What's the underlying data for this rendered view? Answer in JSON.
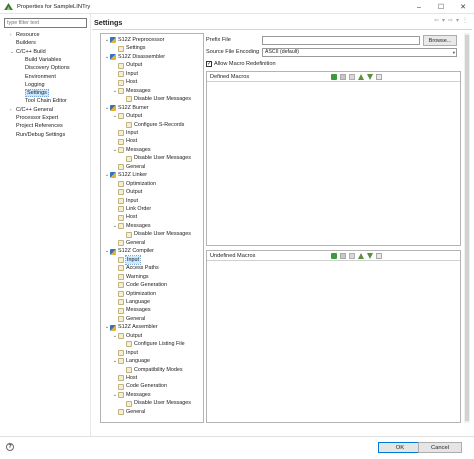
{
  "window": {
    "title": "Properties for SampleLINTry",
    "controls": [
      "–",
      "☐",
      "✕"
    ]
  },
  "filter": {
    "placeholder": "type filter text"
  },
  "nav": [
    {
      "label": "Resource",
      "depth": 1,
      "toggle": "›"
    },
    {
      "label": "Builders",
      "depth": 1,
      "toggle": ""
    },
    {
      "label": "C/C++ Build",
      "depth": 1,
      "toggle": "⌄"
    },
    {
      "label": "Build Variables",
      "depth": 2,
      "toggle": ""
    },
    {
      "label": "Discovery Options",
      "depth": 2,
      "toggle": ""
    },
    {
      "label": "Environment",
      "depth": 2,
      "toggle": ""
    },
    {
      "label": "Logging",
      "depth": 2,
      "toggle": ""
    },
    {
      "label": "Settings",
      "depth": 2,
      "toggle": "",
      "selected": true
    },
    {
      "label": "Tool Chain Editor",
      "depth": 2,
      "toggle": ""
    },
    {
      "label": "C/C++ General",
      "depth": 1,
      "toggle": "›"
    },
    {
      "label": "Processor Expert",
      "depth": 1,
      "toggle": ""
    },
    {
      "label": "Project References",
      "depth": 1,
      "toggle": ""
    },
    {
      "label": "Run/Debug Settings",
      "depth": 1,
      "toggle": ""
    }
  ],
  "page_title": "Settings",
  "nav_arrows": [
    "⇦",
    "▾",
    "⇨",
    "▾",
    "⋮"
  ],
  "tool_tree": [
    {
      "label": "S12Z Preprocessor",
      "depth": 0,
      "type": "tool"
    },
    {
      "label": "Settings",
      "depth": 1,
      "type": "opt"
    },
    {
      "label": "S12Z Disassembler",
      "depth": 0,
      "type": "tool"
    },
    {
      "label": "Output",
      "depth": 1,
      "type": "opt"
    },
    {
      "label": "Input",
      "depth": 1,
      "type": "opt"
    },
    {
      "label": "Host",
      "depth": 1,
      "type": "opt"
    },
    {
      "label": "Messages",
      "depth": 1,
      "type": "opt",
      "expanded": true
    },
    {
      "label": "Disable User Messages",
      "depth": 2,
      "type": "opt"
    },
    {
      "label": "S12Z Burner",
      "depth": 0,
      "type": "tool"
    },
    {
      "label": "Output",
      "depth": 1,
      "type": "opt",
      "expanded": true
    },
    {
      "label": "Configure S-Records",
      "depth": 2,
      "type": "opt"
    },
    {
      "label": "Input",
      "depth": 1,
      "type": "opt"
    },
    {
      "label": "Host",
      "depth": 1,
      "type": "opt"
    },
    {
      "label": "Messages",
      "depth": 1,
      "type": "opt",
      "expanded": true
    },
    {
      "label": "Disable User Messages",
      "depth": 2,
      "type": "opt"
    },
    {
      "label": "General",
      "depth": 1,
      "type": "opt"
    },
    {
      "label": "S12Z Linker",
      "depth": 0,
      "type": "tool"
    },
    {
      "label": "Optimization",
      "depth": 1,
      "type": "opt"
    },
    {
      "label": "Output",
      "depth": 1,
      "type": "opt"
    },
    {
      "label": "Input",
      "depth": 1,
      "type": "opt"
    },
    {
      "label": "Link Order",
      "depth": 1,
      "type": "opt"
    },
    {
      "label": "Host",
      "depth": 1,
      "type": "opt"
    },
    {
      "label": "Messages",
      "depth": 1,
      "type": "opt",
      "expanded": true
    },
    {
      "label": "Disable User Messages",
      "depth": 2,
      "type": "opt"
    },
    {
      "label": "General",
      "depth": 1,
      "type": "opt"
    },
    {
      "label": "S12Z Compiler",
      "depth": 0,
      "type": "tool"
    },
    {
      "label": "Input",
      "depth": 1,
      "type": "opt",
      "selected": true
    },
    {
      "label": "Access Paths",
      "depth": 1,
      "type": "opt"
    },
    {
      "label": "Warnings",
      "depth": 1,
      "type": "opt"
    },
    {
      "label": "Code Generation",
      "depth": 1,
      "type": "opt"
    },
    {
      "label": "Optimization",
      "depth": 1,
      "type": "opt"
    },
    {
      "label": "Language",
      "depth": 1,
      "type": "opt"
    },
    {
      "label": "Messages",
      "depth": 1,
      "type": "opt"
    },
    {
      "label": "General",
      "depth": 1,
      "type": "opt"
    },
    {
      "label": "S12Z Assembler",
      "depth": 0,
      "type": "tool"
    },
    {
      "label": "Output",
      "depth": 1,
      "type": "opt",
      "expanded": true
    },
    {
      "label": "Configure Listing File",
      "depth": 2,
      "type": "opt"
    },
    {
      "label": "Input",
      "depth": 1,
      "type": "opt"
    },
    {
      "label": "Language",
      "depth": 1,
      "type": "opt",
      "expanded": true
    },
    {
      "label": "Compatibility Modes",
      "depth": 2,
      "type": "opt"
    },
    {
      "label": "Host",
      "depth": 1,
      "type": "opt"
    },
    {
      "label": "Code Generation",
      "depth": 1,
      "type": "opt"
    },
    {
      "label": "Messages",
      "depth": 1,
      "type": "opt",
      "expanded": true
    },
    {
      "label": "Disable User Messages",
      "depth": 2,
      "type": "opt"
    },
    {
      "label": "General",
      "depth": 1,
      "type": "opt"
    }
  ],
  "form": {
    "prefix_label": "Prefix File",
    "prefix_value": "",
    "browse_label": "Browse...",
    "encoding_label": "Source File Encoding",
    "encoding_value": "ASCII (default)",
    "allow_redef_label": "Allow Macro Redefinition",
    "allow_redef_checked": true,
    "defined_macros_title": "Defined Macros",
    "undefined_macros_title": "Undefined Macros"
  },
  "buttons": {
    "ok": "OK",
    "cancel": "Cancel",
    "help": "?"
  },
  "colors": {
    "selection": "#cce8ff",
    "ok_border": "#0078d7"
  }
}
